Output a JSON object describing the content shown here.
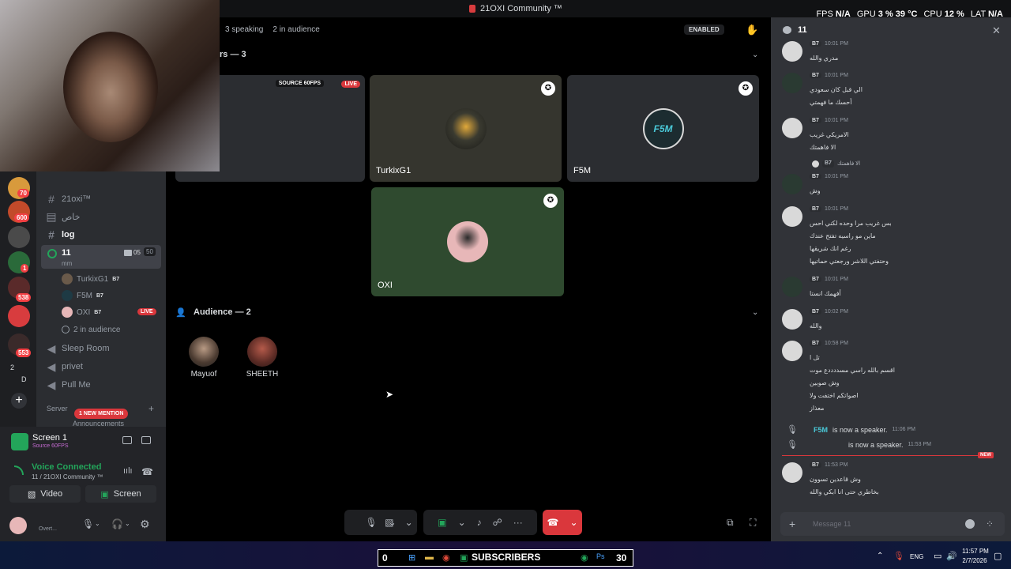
{
  "window": {
    "title": "21OXI Community ™"
  },
  "perf": {
    "fps_label": "FPS",
    "fps": "N/A",
    "gpu_label": "GPU",
    "gpu": "3 %",
    "gpu_temp": "39 °C",
    "cpu_label": "CPU",
    "cpu": "12 %",
    "lat_label": "LAT",
    "lat": "N/A"
  },
  "rail": {
    "badges": [
      "70",
      "600",
      "1",
      "538",
      "553"
    ],
    "counter_top": "2",
    "counter_bottom": "D"
  },
  "sidebar": {
    "channels": [
      {
        "name": "21oxi™"
      },
      {
        "name": "خاص"
      },
      {
        "name": "log"
      }
    ],
    "voice_channel": {
      "name": "11",
      "sub": "mm",
      "count_a": "05",
      "count_b": "50"
    },
    "voice_members": [
      {
        "name": "TurkixG1",
        "boost": "B7"
      },
      {
        "name": "F5M",
        "boost": "B7"
      },
      {
        "name": "OXI",
        "boost": "B7",
        "live": "LIVE"
      }
    ],
    "audience_count": "2 in audience",
    "other_channels": [
      "Sleep Room",
      "privet",
      "Pull Me"
    ],
    "server_label": "Server",
    "mention_badge": "1 NEW MENTION",
    "cut_label": "Announcements"
  },
  "userpanel": {
    "screen_title": "Screen 1",
    "screen_sub": "Source 60FPS",
    "voice_status": "Voice Connected",
    "voice_location": "11 / 21OXI Community ™",
    "video_label": "Video",
    "screen_label": "Screen",
    "user_status": "Overt..."
  },
  "stage": {
    "speaking": "3 speaking",
    "audience": "2 in audience",
    "enabled_badge": "ENABLED",
    "speakers_header": "rs — 3",
    "source_label": "SOURCE 60FPS",
    "live_label": "LIVE",
    "tiles": [
      {
        "name": "TurkixG1"
      },
      {
        "name": "F5M",
        "logo": "F5M"
      },
      {
        "name": "OXI"
      }
    ],
    "audience_header": "Audience — 2",
    "audience_members": [
      {
        "name": "Mayuof"
      },
      {
        "name": "SHEETH"
      }
    ]
  },
  "chat": {
    "title": "11",
    "messages": [
      {
        "time": "10:01 PM",
        "tag": "B7",
        "lines": [
          "مدري والله"
        ]
      },
      {
        "time": "10:01 PM",
        "tag": "B7",
        "lines": [
          "الي قبل كان سعودي",
          "أحسك ما فهمتي"
        ]
      },
      {
        "time": "10:01 PM",
        "tag": "B7",
        "lines": [
          "الامريكي غريب",
          "الا فاهمتك"
        ]
      },
      {
        "reply": "الا فاهمتك",
        "time": "10:01 PM",
        "tag": "B7",
        "lines": [
          "وش"
        ]
      },
      {
        "time": "10:01 PM",
        "tag": "B7",
        "lines": [
          "بس غريب مرا وحده لكني احس",
          "ماين مو راسيه تفتح عندك",
          "رغم انك شريقها",
          "وحتفتي اللاشر ورجعتي حماتيها"
        ]
      },
      {
        "time": "10:01 PM",
        "tag": "B7",
        "lines": [
          "أفهمك انستا"
        ]
      },
      {
        "time": "10:02 PM",
        "tag": "B7",
        "lines": [
          "والله"
        ]
      },
      {
        "time": "10:58 PM",
        "tag": "B7",
        "lines": [
          "تل ا",
          "اقسم بالله راسي مسددددع موت",
          "وش صوبين",
          "اصواتكم اختفت ولا",
          "معذاز"
        ]
      }
    ],
    "system": [
      {
        "name": "F5M",
        "text": "is now a speaker.",
        "time": "11:06 PM"
      },
      {
        "name": "",
        "text": "is now a speaker.",
        "time": "11:53 PM"
      }
    ],
    "new_label": "NEW",
    "last_message": {
      "time": "11:53 PM",
      "tag": "B7",
      "lines": [
        "وش قاعدين تسوون",
        "بخاطري حتى انا ابكي والله"
      ]
    },
    "input_placeholder": "Message 11"
  },
  "taskbar": {
    "counter_left": "0",
    "subscribers_label": "SUBSCRIBERS",
    "counter_right": "30",
    "lang": "ENG",
    "time": "11:57 PM",
    "date": "2/7/2026"
  },
  "colors": {
    "accent_green": "#23a55a",
    "live_red": "#da373c",
    "chat_bg": "#313338",
    "sidebar_bg": "#2b2d31"
  }
}
